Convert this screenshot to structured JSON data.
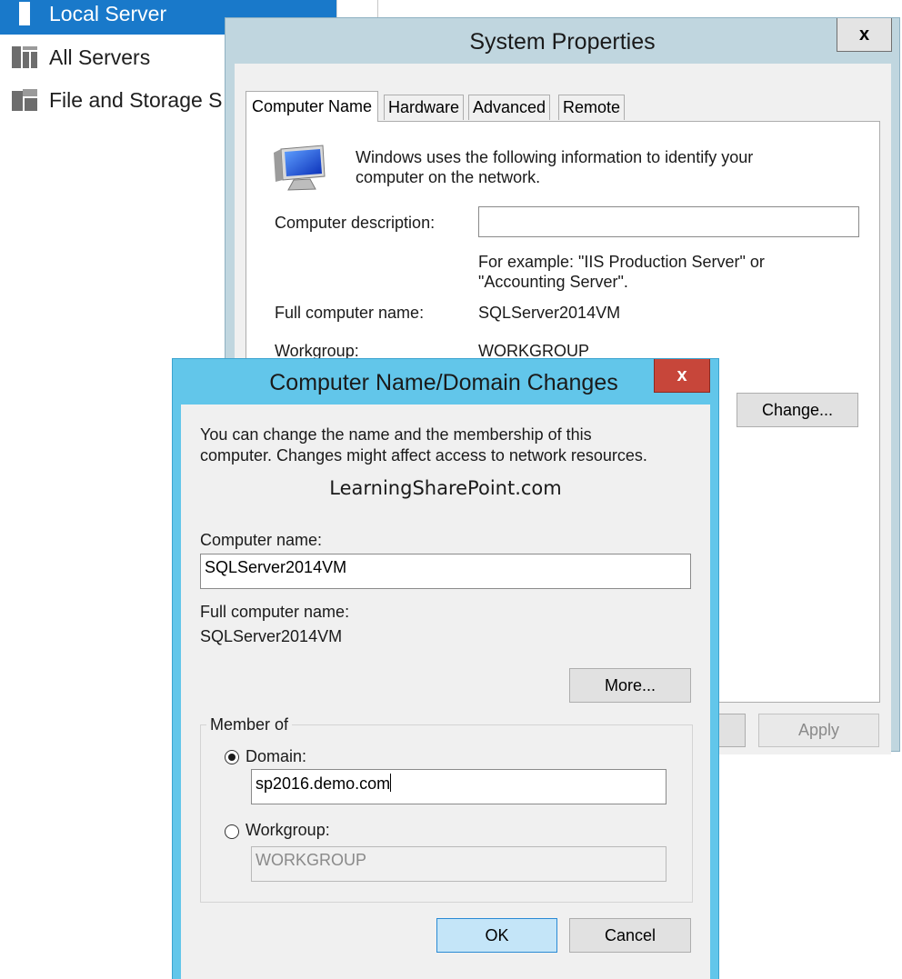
{
  "sidebar": {
    "items": [
      {
        "label": "Local Server",
        "selected": true,
        "icon": "local-server-icon"
      },
      {
        "label": "All Servers",
        "selected": false,
        "icon": "all-servers-icon"
      },
      {
        "label": "File and Storage S",
        "selected": false,
        "icon": "file-storage-icon"
      }
    ]
  },
  "system_properties": {
    "title": "System Properties",
    "close_label": "x",
    "tabs": [
      {
        "label": "Computer Name",
        "active": true
      },
      {
        "label": "Hardware",
        "active": false
      },
      {
        "label": "Advanced",
        "active": false
      },
      {
        "label": "Remote",
        "active": false
      }
    ],
    "intro_line1": "Windows uses the following information to identify your",
    "intro_line2": "computer on the network.",
    "description_label": "Computer description:",
    "description_value": "",
    "example_line1": "For example: \"IIS Production Server\" or",
    "example_line2": "\"Accounting Server\".",
    "full_name_label": "Full computer name:",
    "full_name_value": "SQLServer2014VM",
    "workgroup_label": "Workgroup:",
    "workgroup_value": "WORKGROUP",
    "change_button": "Change...",
    "apply_button": "Apply"
  },
  "name_domain_dialog": {
    "title": "Computer Name/Domain Changes",
    "close_label": "x",
    "intro_line1": "You can change the name and the membership of this",
    "intro_line2": "computer. Changes might affect access to network resources.",
    "watermark": "LearningSharePoint.com",
    "computer_name_label": "Computer name:",
    "computer_name_value": "SQLServer2014VM",
    "full_name_label": "Full computer name:",
    "full_name_value": "SQLServer2014VM",
    "more_button": "More...",
    "member_of_label": "Member of",
    "domain_label": "Domain:",
    "domain_value": "sp2016.demo.com",
    "domain_selected": true,
    "workgroup_label": "Workgroup:",
    "workgroup_value": "WORKGROUP",
    "ok_button": "OK",
    "cancel_button": "Cancel"
  },
  "colors": {
    "selection_blue": "#1979ca",
    "dialog_frame": "#62c6ea",
    "close_red": "#c7463a",
    "inactive_frame": "#c0d6df"
  }
}
